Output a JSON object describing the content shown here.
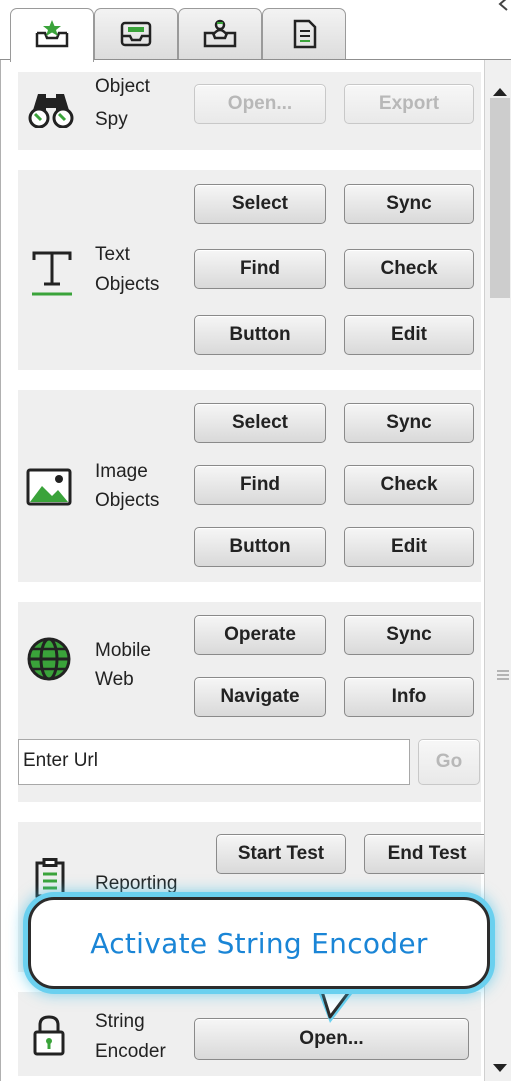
{
  "tabs": [
    {
      "icon": "star-tray-icon",
      "active": true
    },
    {
      "icon": "tray-icon",
      "active": false
    },
    {
      "icon": "user-tray-icon",
      "active": false
    },
    {
      "icon": "document-icon",
      "active": false
    }
  ],
  "object_spy": {
    "label_line1": "Object",
    "label_line2": "Spy",
    "open_label": "Open...",
    "export_label": "Export"
  },
  "text_objects": {
    "label_line1": "Text",
    "label_line2": "Objects",
    "select": "Select",
    "sync": "Sync",
    "find": "Find",
    "check": "Check",
    "button": "Button",
    "edit": "Edit"
  },
  "image_objects": {
    "label_line1": "Image",
    "label_line2": "Objects",
    "select": "Select",
    "sync": "Sync",
    "find": "Find",
    "check": "Check",
    "button": "Button",
    "edit": "Edit"
  },
  "mobile_web": {
    "label_line1": "Mobile",
    "label_line2": "Web",
    "operate": "Operate",
    "sync": "Sync",
    "navigate": "Navigate",
    "info": "Info"
  },
  "url_bar": {
    "placeholder": "Enter Url",
    "go_label": "Go"
  },
  "reporting": {
    "label": "Reporting",
    "start_test": "Start Test",
    "end_test": "End Test"
  },
  "string_encoder": {
    "label_line1": "String",
    "label_line2": "Encoder",
    "open_label": "Open..."
  },
  "callout": {
    "text": "Activate String Encoder"
  },
  "colors": {
    "accent_green": "#3aa33a",
    "callout_glow": "#6ad0ef",
    "callout_text": "#1a85d6"
  }
}
